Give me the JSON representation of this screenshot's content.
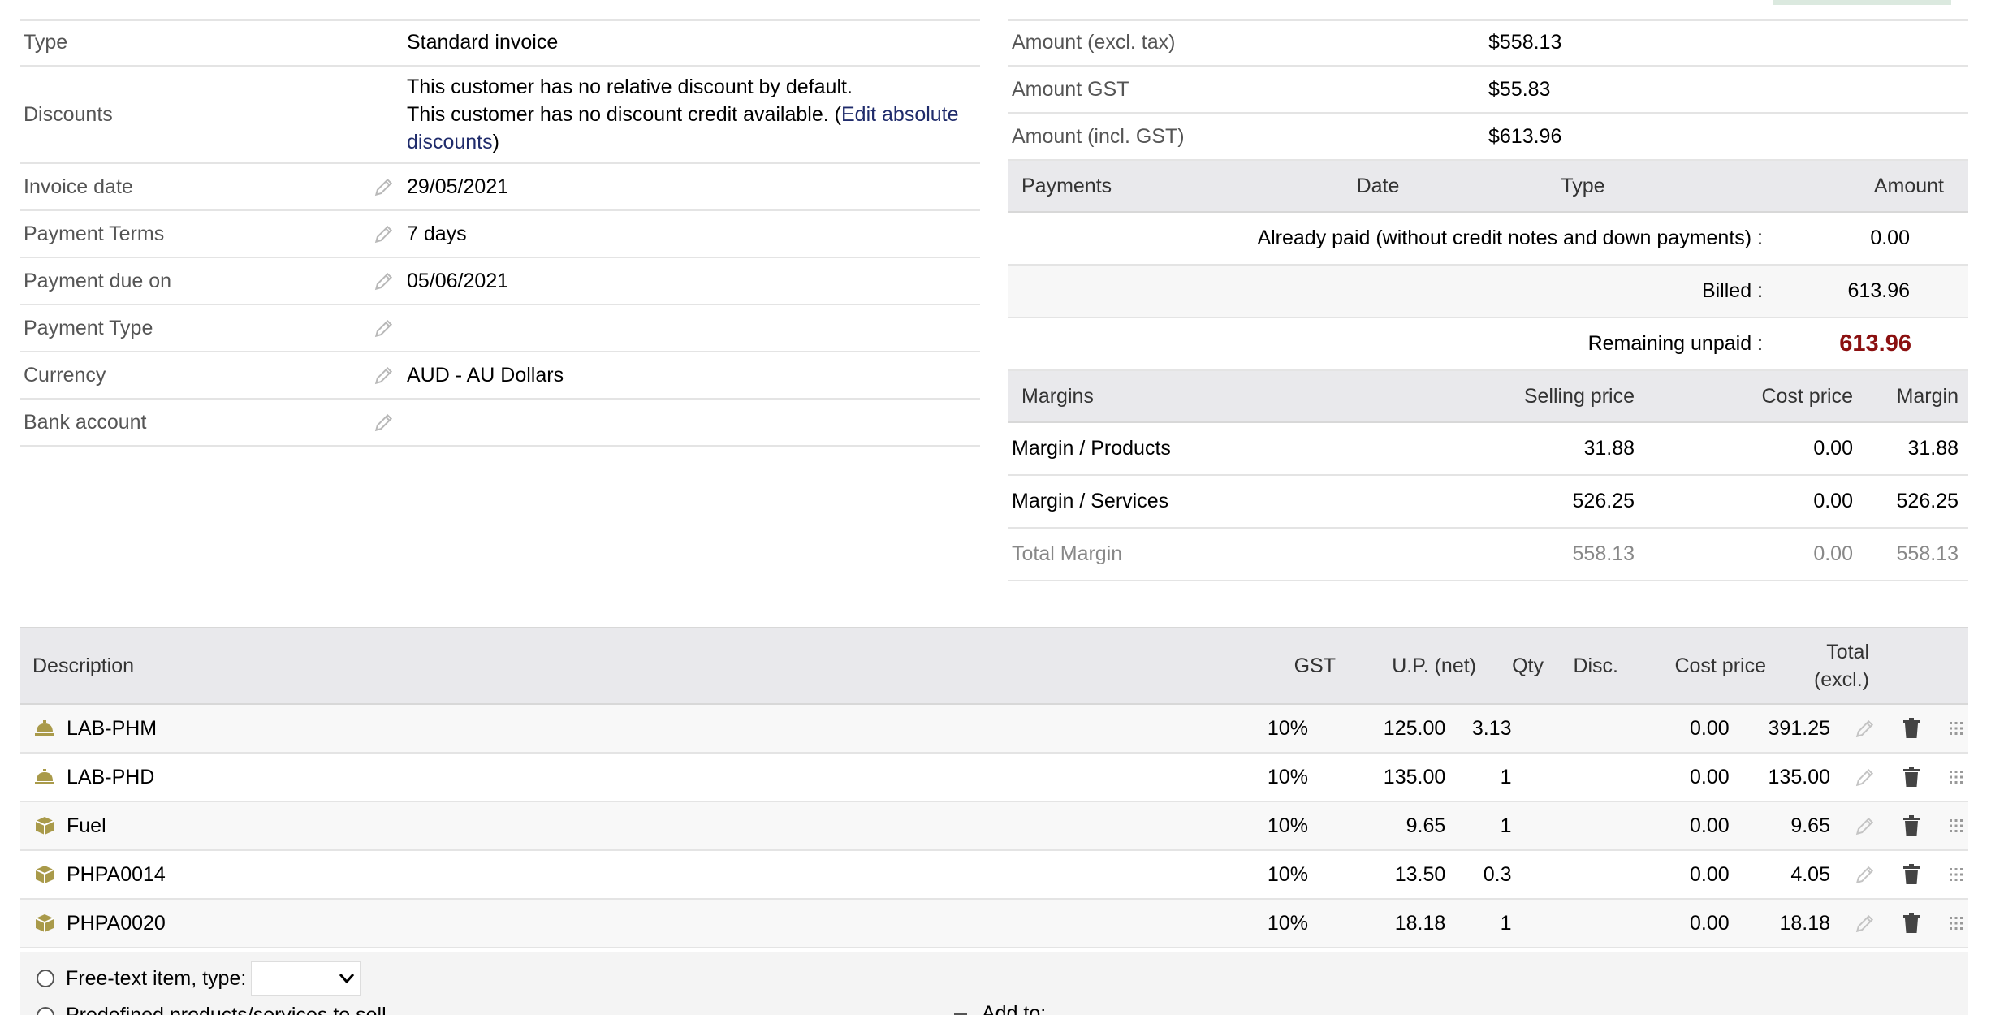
{
  "fields": [
    {
      "label": "Type",
      "value": "Standard invoice",
      "editable": false
    },
    {
      "label": "Invoice date",
      "value": "29/05/2021",
      "editable": true
    },
    {
      "label": "Payment Terms",
      "value": "7 days",
      "editable": true
    },
    {
      "label": "Payment due on",
      "value": "05/06/2021",
      "editable": true
    },
    {
      "label": "Payment Type",
      "value": "",
      "editable": true
    },
    {
      "label": "Currency",
      "value": "AUD - AU Dollars",
      "editable": true
    },
    {
      "label": "Bank account",
      "value": "",
      "editable": true
    }
  ],
  "discounts": {
    "label": "Discounts",
    "line1": "This customer has no relative discount by default.",
    "line2_prefix": "This customer has no discount credit available. (",
    "link": "Edit absolute discounts",
    "line2_suffix": ")"
  },
  "amounts": [
    {
      "label": "Amount (excl. tax)",
      "value": "$558.13"
    },
    {
      "label": "Amount GST",
      "value": "$55.83"
    },
    {
      "label": "Amount (incl. GST)",
      "value": "$613.96"
    }
  ],
  "payments": {
    "headers": [
      "Payments",
      "Date",
      "Type",
      "Amount"
    ],
    "already_paid_label": "Already paid (without credit notes and down payments) :",
    "already_paid_value": "0.00",
    "billed_label": "Billed :",
    "billed_value": "613.96",
    "remaining_label": "Remaining unpaid :",
    "remaining_value": "613.96",
    "remaining_color": "#8b1010"
  },
  "margins": {
    "headers": [
      "Margins",
      "Selling price",
      "Cost price",
      "Margin"
    ],
    "rows": [
      {
        "label": "Margin / Products",
        "selling": "31.88",
        "cost": "0.00",
        "margin": "31.88"
      },
      {
        "label": "Margin / Services",
        "selling": "526.25",
        "cost": "0.00",
        "margin": "526.25"
      },
      {
        "label": "Total Margin",
        "selling": "558.13",
        "cost": "0.00",
        "margin": "558.13"
      }
    ]
  },
  "lines": {
    "headers": {
      "description": "Description",
      "gst": "GST",
      "up": "U.P. (net)",
      "qty": "Qty",
      "disc": "Disc.",
      "cost": "Cost price",
      "total_line1": "Total",
      "total_line2": "(excl.)"
    },
    "rows": [
      {
        "icon": "service-bell-icon",
        "ref": "LAB-PHM",
        "gst": "10%",
        "up": "125.00",
        "qty": "3.13",
        "disc": "",
        "cost": "0.00",
        "total": "391.25"
      },
      {
        "icon": "service-bell-icon",
        "ref": "LAB-PHD",
        "gst": "10%",
        "up": "135.00",
        "qty": "1",
        "disc": "",
        "cost": "0.00",
        "total": "135.00"
      },
      {
        "icon": "product-box-icon",
        "ref": "Fuel",
        "gst": "10%",
        "up": "9.65",
        "qty": "1",
        "disc": "",
        "cost": "0.00",
        "total": "9.65"
      },
      {
        "icon": "product-box-icon",
        "ref": "PHPA0014",
        "gst": "10%",
        "up": "13.50",
        "qty": "0.3",
        "disc": "",
        "cost": "0.00",
        "total": "4.05"
      },
      {
        "icon": "product-box-icon",
        "ref": "PHPA0020",
        "gst": "10%",
        "up": "18.18",
        "qty": "1",
        "disc": "",
        "cost": "0.00",
        "total": "18.18"
      }
    ]
  },
  "add_line": {
    "free_text_label": "Free-text item, type:",
    "predefined_label": "Predefined products/services to sell",
    "add_to_label": "Add to:"
  },
  "colors": {
    "icon_gold": "#a99a4a",
    "link": "#1f2b6b",
    "header_bg": "#e9e9ec"
  }
}
